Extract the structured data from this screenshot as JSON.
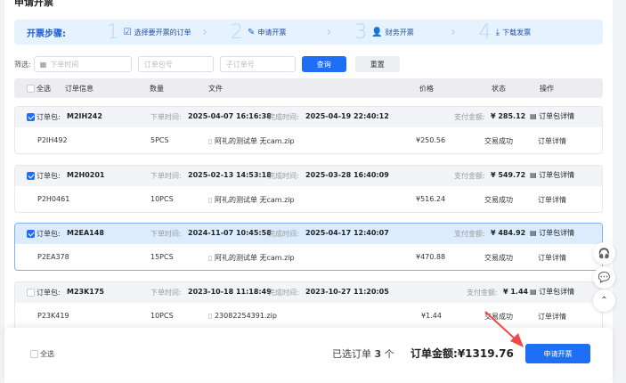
{
  "page": {
    "title": "申请开票"
  },
  "steps": {
    "label": "开票步骤:",
    "items": [
      {
        "num": "1",
        "icon": "checklist-icon",
        "text": "选择要开票的订单"
      },
      {
        "num": "2",
        "icon": "edit-doc-icon",
        "text": "申请开票"
      },
      {
        "num": "3",
        "icon": "finance-person-icon",
        "text": "财务开票"
      },
      {
        "num": "4",
        "icon": "download-icon",
        "text": "下载发票"
      }
    ]
  },
  "filter": {
    "label": "筛选:",
    "date_placeholder": "下单时间",
    "package_placeholder": "订单包号",
    "suborder_placeholder": "子订单号",
    "query": "查询",
    "reset": "重置"
  },
  "table": {
    "select_all": "全选",
    "headers": [
      "订单信息",
      "数量",
      "文件",
      "价格",
      "状态",
      "操作"
    ]
  },
  "labels": {
    "package": "订单包:",
    "order_time": "下单时间:",
    "finish_time": "完成时间:",
    "paid": "支付金额:",
    "package_detail": "订单包详情",
    "order_detail": "订单详情"
  },
  "groups": [
    {
      "checked": true,
      "id": "M2IH242",
      "order_time": "2025-04-07 16:16:38",
      "finish_time": "2025-04-19 22:40:12",
      "paid": "¥ 285.12",
      "sub": {
        "id": "P2IH492",
        "qty": "5PCS",
        "file": "阿礼的测试单 无cam.zip",
        "price": "¥250.56",
        "status": "交易成功"
      }
    },
    {
      "checked": true,
      "id": "M2H0201",
      "order_time": "2025-02-13 14:53:18",
      "finish_time": "2025-03-28 16:40:09",
      "paid": "¥ 549.72",
      "sub": {
        "id": "P2H0461",
        "qty": "10PCS",
        "file": "阿礼的测试单 无cam.zip",
        "price": "¥516.24",
        "status": "交易成功"
      }
    },
    {
      "checked": true,
      "id": "M2EA148",
      "order_time": "2024-11-07 10:45:58",
      "finish_time": "2025-04-17 12:40:07",
      "paid": "¥ 484.92",
      "sub": {
        "id": "P2EA378",
        "qty": "15PCS",
        "file": "阿礼的测试单 无cam.zip",
        "price": "¥470.88",
        "status": "交易成功"
      }
    },
    {
      "checked": false,
      "id": "M23K175",
      "order_time": "2023-10-18 11:18:49",
      "finish_time": "2023-10-27 11:20:05",
      "paid": "¥ 1.44",
      "sub": {
        "id": "P23K419",
        "qty": "10PCS",
        "file": "23082254391.zip",
        "price": "¥1.44",
        "status": "交易成功"
      }
    }
  ],
  "footer": {
    "select_all": "全选",
    "selected_prefix": "已选订单",
    "selected_count": "3",
    "selected_suffix": "个",
    "amount_label": "订单金额:",
    "amount": "¥1319.76",
    "apply": "申请开票"
  },
  "colors": {
    "accent": "#1e6ff5",
    "arrow": "#f04848"
  }
}
